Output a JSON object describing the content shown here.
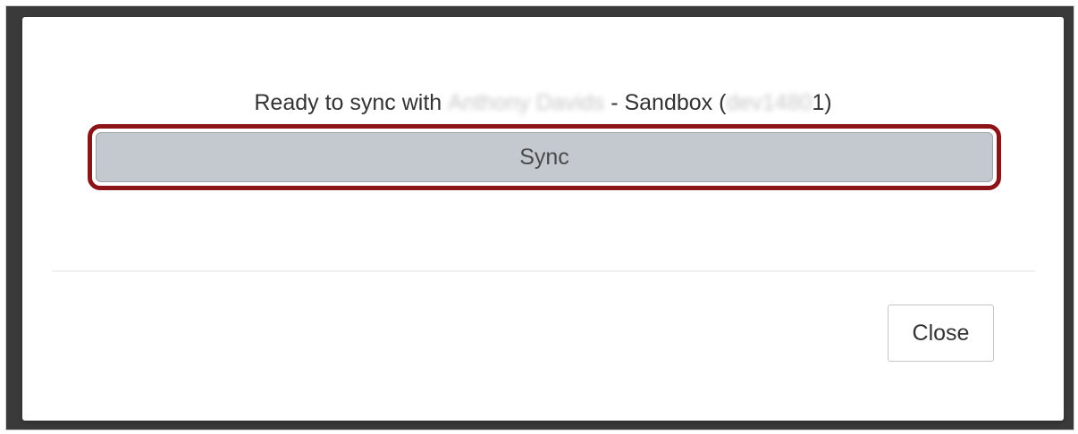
{
  "modal": {
    "message_prefix": "Ready to sync with",
    "account_name_redacted": "Anthony Davids",
    "message_middle": "- Sandbox (",
    "account_id_redacted": "dev1480",
    "message_suffix": "1)",
    "sync_label": "Sync",
    "close_label": "Close"
  },
  "colors": {
    "highlight_border": "#8b1419",
    "sync_button_bg": "#c3c9cf",
    "backdrop": "#2b2b2b"
  }
}
